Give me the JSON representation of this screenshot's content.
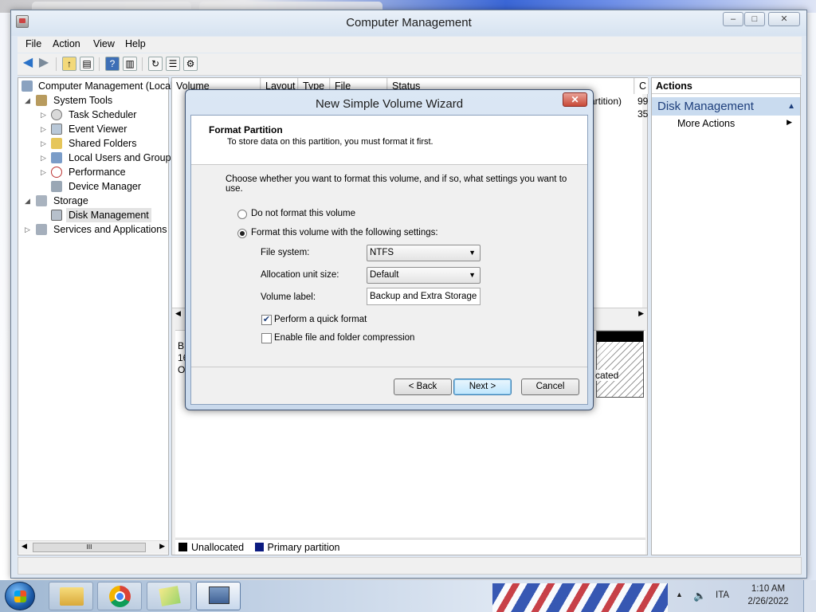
{
  "window": {
    "title": "Computer Management",
    "min": "–",
    "max": "□",
    "close": "✕"
  },
  "menubar": {
    "items": [
      "File",
      "Action",
      "View",
      "Help"
    ]
  },
  "tree": {
    "items": [
      {
        "label": "Computer Management (Local"
      },
      {
        "label": "System Tools"
      },
      {
        "label": "Task Scheduler"
      },
      {
        "label": "Event Viewer"
      },
      {
        "label": "Shared Folders"
      },
      {
        "label": "Local Users and Groups"
      },
      {
        "label": "Performance"
      },
      {
        "label": "Device Manager"
      },
      {
        "label": "Storage"
      },
      {
        "label": "Disk Management"
      },
      {
        "label": "Services and Applications"
      }
    ],
    "scroll_grip": "III"
  },
  "volume_list": {
    "columns": [
      "Volume",
      "Layout",
      "Type",
      "File System",
      "Status",
      "C"
    ],
    "row_fragments": [
      "artition)",
      "99",
      "35"
    ]
  },
  "disk_fragments": [
    "B",
    "16",
    "O",
    "cated"
  ],
  "legend": {
    "items": [
      {
        "label": "Unallocated",
        "color": "#000000"
      },
      {
        "label": "Primary partition",
        "color": "#0b1a80"
      }
    ]
  },
  "actions": {
    "header": "Actions",
    "section": "Disk Management",
    "item": "More Actions"
  },
  "dialog": {
    "title": "New Simple Volume Wizard",
    "close": "✕",
    "header_title": "Format Partition",
    "header_subtitle": "To store data on this partition, you must format it first.",
    "prompt": "Choose whether you want to format this volume, and if so, what settings you want to use.",
    "option_no_format": "Do not format this volume",
    "option_format": "Format this volume with the following settings:",
    "file_system_label": "File system:",
    "file_system_value": "NTFS",
    "alloc_label": "Allocation unit size:",
    "alloc_value": "Default",
    "volume_label_label": "Volume label:",
    "volume_label_value": "Backup and Extra Storage",
    "quick_format_label": "Perform a quick format",
    "quick_format_checked": true,
    "compression_label": "Enable file and folder compression",
    "compression_checked": false,
    "back": "< Back",
    "next": "Next >",
    "cancel": "Cancel"
  },
  "taskbar": {
    "language": "ITA",
    "time": "1:10 AM",
    "date": "2/26/2022"
  },
  "colors": {
    "accent": "#1e3f7c",
    "selection": "#c9dbef"
  }
}
